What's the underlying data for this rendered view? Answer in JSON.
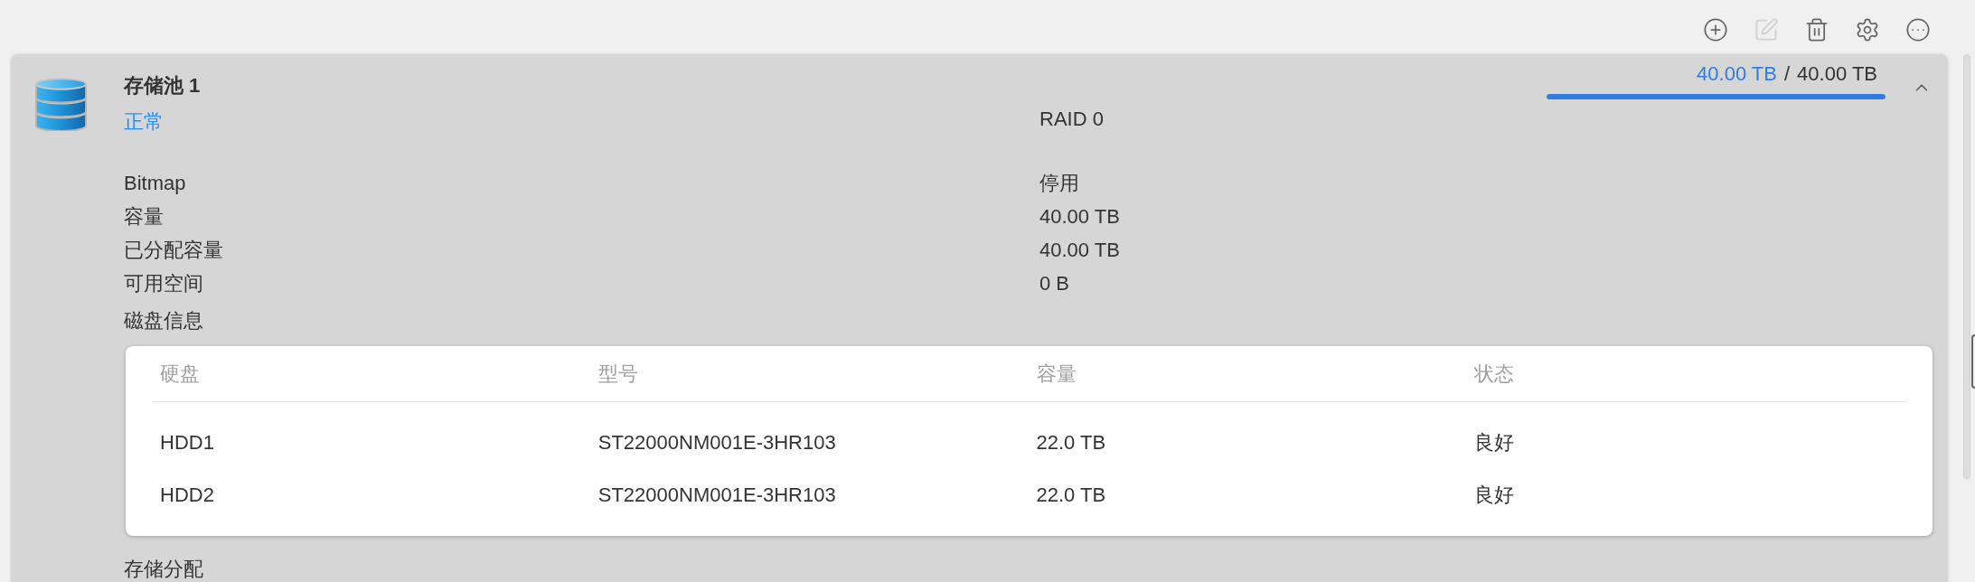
{
  "toolbar": [
    {
      "kind": "add",
      "disabled": false
    },
    {
      "kind": "edit",
      "disabled": true
    },
    {
      "kind": "delete",
      "disabled": false
    },
    {
      "kind": "settings",
      "disabled": false
    },
    {
      "kind": "more",
      "disabled": false
    }
  ],
  "pool": {
    "title": "存储池 1",
    "status": "正常",
    "raid": "RAID 0",
    "used": "40.00 TB",
    "separator": "/",
    "total": "40.00 TB",
    "level": 1,
    "expanded": true,
    "details": [
      {
        "label": "Bitmap",
        "value": "停用"
      },
      {
        "label": "容量",
        "value": "40.00 TB"
      },
      {
        "label": "已分配容量",
        "value": "40.00 TB"
      },
      {
        "label": "可用空间",
        "value": "0 B"
      }
    ],
    "disk_section": "磁盘信息",
    "disk_table": {
      "columns": [
        "硬盘",
        "型号",
        "容量",
        "状态"
      ],
      "rows": [
        [
          "HDD1",
          "ST22000NM001E-3HR103",
          "22.0 TB",
          "良好"
        ],
        [
          "HDD2",
          "ST22000NM001E-3HR103",
          "22.0 TB",
          "良好"
        ]
      ]
    },
    "allocation_section": "存储分配"
  }
}
